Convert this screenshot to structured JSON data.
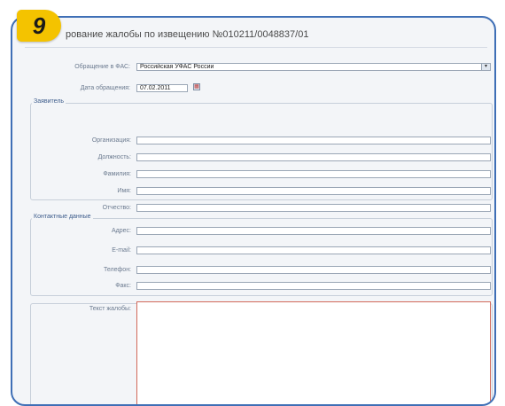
{
  "badge": {
    "number": "9"
  },
  "window": {
    "title": "рование жалобы по извещению №010211/0048837/01"
  },
  "form": {
    "appeal_to_label": "Обращение в ФАС:",
    "appeal_to_value": "Российская УФАС России",
    "date_label": "Дата обращения:",
    "date_value": "07.02.2011",
    "applicant_legend": "Заявитель",
    "organization_label": "Организация:",
    "position_label": "Должность:",
    "last_name_label": "Фамилия:",
    "first_name_label": "Имя:",
    "patronymic_label": "Отчество:",
    "contacts_legend": "Контактные данные",
    "address_label": "Адрес:",
    "email_label": "E-mail:",
    "phone_label": "Телефон:",
    "fax_label": "Факс:",
    "complaint_text_label": "Текст жалобы:"
  }
}
